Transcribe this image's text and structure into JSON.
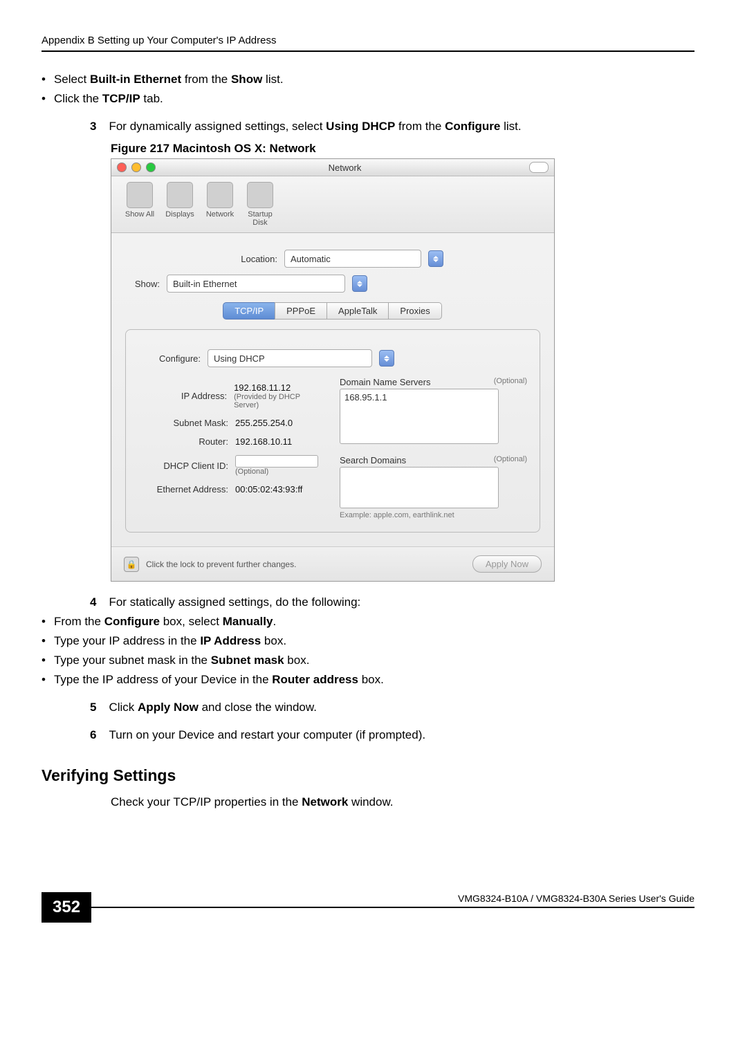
{
  "header": "Appendix B Setting up Your Computer's IP Address",
  "bullets_top": [
    {
      "pre": "Select ",
      "b1": "Built-in Ethernet",
      "mid": " from the ",
      "b2": "Show",
      "post": " list."
    },
    {
      "pre": "Click the ",
      "b1": "TCP/IP",
      "post": " tab."
    }
  ],
  "step3": {
    "num": "3",
    "pre": "For dynamically assigned settings, select ",
    "b1": "Using DHCP",
    "mid": " from the ",
    "b2": "Configure",
    "post": " list."
  },
  "figure_caption": "Figure 217   Macintosh OS X: Network",
  "mac_window": {
    "title": "Network",
    "toolbar": [
      "Show All",
      "Displays",
      "Network",
      "Startup Disk"
    ],
    "location_label": "Location:",
    "location_value": "Automatic",
    "show_label": "Show:",
    "show_value": "Built-in Ethernet",
    "tabs": [
      "TCP/IP",
      "PPPoE",
      "AppleTalk",
      "Proxies"
    ],
    "configure_label": "Configure:",
    "configure_value": "Using DHCP",
    "ip_label": "IP Address:",
    "ip_value": "192.168.11.12",
    "ip_sub": "(Provided by DHCP Server)",
    "subnet_label": "Subnet Mask:",
    "subnet_value": "255.255.254.0",
    "router_label": "Router:",
    "router_value": "192.168.10.11",
    "dhcp_label": "DHCP Client ID:",
    "dhcp_sub": "(Optional)",
    "eth_label": "Ethernet Address:",
    "eth_value": "00:05:02:43:93:ff",
    "dns_label": "Domain Name Servers",
    "dns_optional": "(Optional)",
    "dns_value": "168.95.1.1",
    "search_label": "Search Domains",
    "search_optional": "(Optional)",
    "example_text": "Example: apple.com, earthlink.net",
    "lock_text": "Click the lock to prevent further changes.",
    "apply_button": "Apply Now"
  },
  "step4": {
    "num": "4",
    "text": "For statically assigned settings, do the following:"
  },
  "step4_bullets": [
    {
      "pre": "From the ",
      "b1": "Configure",
      "mid": " box, select ",
      "b2": "Manually",
      "post": "."
    },
    {
      "pre": "Type your IP address in the ",
      "b1": "IP Address",
      "post": " box."
    },
    {
      "pre": "Type your subnet mask in the ",
      "b1": "Subnet mask",
      "post": " box."
    },
    {
      "pre": "Type the IP address of your Device in the ",
      "b1": "Router address",
      "post": " box."
    }
  ],
  "step5": {
    "num": "5",
    "pre": "Click ",
    "b1": "Apply Now",
    "post": " and close the window."
  },
  "step6": {
    "num": "6",
    "text": "Turn on your Device and restart your computer (if prompted)."
  },
  "section_heading": "Verifying Settings",
  "verify_text": {
    "pre": "Check your TCP/IP properties in the ",
    "b1": "Network",
    "post": " window."
  },
  "footer": {
    "page_num": "352",
    "guide_text": "VMG8324-B10A / VMG8324-B30A Series User's Guide"
  }
}
